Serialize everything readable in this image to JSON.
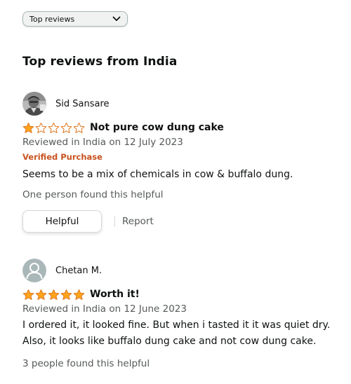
{
  "sort": {
    "selected": "Top reviews"
  },
  "section": {
    "heading": "Top reviews from India"
  },
  "colors": {
    "star_fill": "#ffa41c",
    "star_outline": "#de7921",
    "verified": "#c7511f",
    "secondary_text": "#565959"
  },
  "reviews": [
    {
      "profile_name": "Sid Sansare",
      "avatar_icon": "profile-photo",
      "rating": 1,
      "title": "Not pure cow dung cake",
      "date": "Reviewed in India on 12 July 2023",
      "verified": "Verified Purchase",
      "body": "Seems to be a mix of chemicals in cow & buffalo dung.",
      "helpful_count": "One person found this helpful",
      "helpful_button": "Helpful",
      "report_link": "Report"
    },
    {
      "profile_name": "Chetan M.",
      "avatar_icon": "default-user-icon",
      "rating": 5,
      "title": "Worth it!",
      "date": "Reviewed in India on 12 June 2023",
      "body_line1": "I ordered it, it looked fine. But when i tasted it it was quiet dry.",
      "body_line2": "Also, it looks like buffalo dung cake and not  cow dung cake.",
      "helpful_count": "3 people found this helpful"
    }
  ]
}
